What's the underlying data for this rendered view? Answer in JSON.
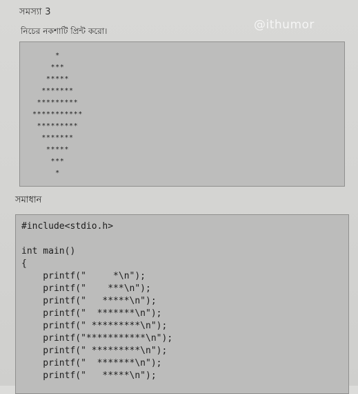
{
  "header": {
    "problem_title": "সমস্যা 3",
    "instruction": "নিচের নকশাটি প্রিন্ট করো।",
    "watermark": "@ithumor"
  },
  "output_pattern": [
    "     *",
    "    ***",
    "   *****",
    "  *******",
    " *********",
    "***********",
    " *********",
    "  *******",
    "   *****",
    "    ***",
    "     *"
  ],
  "solution": {
    "title": "সমাধান",
    "code_lines": [
      "#include<stdio.h>",
      "",
      "int main()",
      "{",
      "    printf(\"     *\\n\");",
      "    printf(\"    ***\\n\");",
      "    printf(\"   *****\\n\");",
      "    printf(\"  *******\\n\");",
      "    printf(\" *********\\n\");",
      "    printf(\"***********\\n\");",
      "    printf(\" *********\\n\");",
      "    printf(\"  *******\\n\");",
      "    printf(\"   *****\\n\");"
    ]
  }
}
